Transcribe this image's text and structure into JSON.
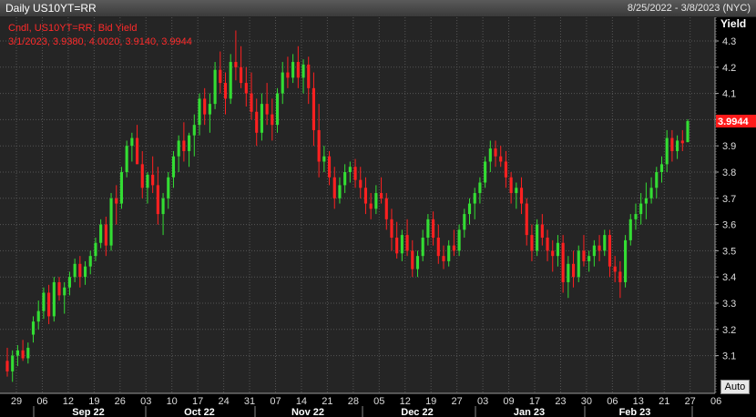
{
  "window": {
    "title": "Daily US10YT=RR",
    "date_range": "8/25/2022 - 3/8/2023 (NYC)"
  },
  "legend": {
    "line1": "Cndl, US10YT=RR, Bid Yield",
    "line2": "3/1/2023, 3.9380, 4.0020, 3.9140, 3.9944"
  },
  "y_axis": {
    "title": "Yield",
    "last_value_label": "3.9944",
    "auto_button": "Auto"
  },
  "colors": {
    "up": "#33dd33",
    "down": "#ff2020",
    "plot_bg": "#252525",
    "grid": "#555555",
    "axis_text": "#dddddd",
    "last_value_bg": "#ff1a1a"
  },
  "chart_data": {
    "type": "candlestick",
    "series_label": "Cndl, US10YT=RR, Bid Yield",
    "ylabel": "Yield",
    "ylim": [
      3.0,
      4.35
    ],
    "y_ticks": [
      3.1,
      3.2,
      3.3,
      3.4,
      3.5,
      3.6,
      3.7,
      3.8,
      3.9,
      4.0,
      4.1,
      4.2,
      4.3
    ],
    "x_day_ticks": [
      "29",
      "06",
      "12",
      "19",
      "26",
      "03",
      "10",
      "17",
      "24",
      "31",
      "07",
      "14",
      "21",
      "28",
      "05",
      "12",
      "19",
      "27",
      "03",
      "09",
      "17",
      "23",
      "30",
      "06",
      "13",
      "21",
      "27",
      "06"
    ],
    "x_month_labels": [
      "Sep 22",
      "Oct 22",
      "Nov 22",
      "Dec 22",
      "Jan 23",
      "Feb 23"
    ],
    "grid": "on",
    "last": {
      "date": "3/1/2023",
      "open": 3.938,
      "high": 4.002,
      "low": 3.914,
      "close": 3.9944
    },
    "candles": [
      [
        3.08,
        3.13,
        3.02,
        3.04
      ],
      [
        3.04,
        3.12,
        3.0,
        3.1
      ],
      [
        3.1,
        3.14,
        3.06,
        3.12
      ],
      [
        3.12,
        3.16,
        3.08,
        3.09
      ],
      [
        3.09,
        3.15,
        3.07,
        3.13
      ],
      [
        3.18,
        3.25,
        3.15,
        3.23
      ],
      [
        3.23,
        3.31,
        3.2,
        3.27
      ],
      [
        3.27,
        3.36,
        3.24,
        3.34
      ],
      [
        3.34,
        3.37,
        3.22,
        3.25
      ],
      [
        3.25,
        3.4,
        3.23,
        3.38
      ],
      [
        3.38,
        3.4,
        3.31,
        3.33
      ],
      [
        3.33,
        3.38,
        3.26,
        3.36
      ],
      [
        3.36,
        3.42,
        3.33,
        3.4
      ],
      [
        3.4,
        3.47,
        3.38,
        3.45
      ],
      [
        3.45,
        3.48,
        3.36,
        3.4
      ],
      [
        3.4,
        3.46,
        3.37,
        3.44
      ],
      [
        3.44,
        3.5,
        3.41,
        3.48
      ],
      [
        3.48,
        3.55,
        3.46,
        3.53
      ],
      [
        3.53,
        3.62,
        3.51,
        3.6
      ],
      [
        3.6,
        3.63,
        3.48,
        3.52
      ],
      [
        3.52,
        3.72,
        3.5,
        3.7
      ],
      [
        3.7,
        3.75,
        3.6,
        3.68
      ],
      [
        3.68,
        3.82,
        3.66,
        3.8
      ],
      [
        3.8,
        3.92,
        3.78,
        3.9
      ],
      [
        3.9,
        3.95,
        3.84,
        3.93
      ],
      [
        3.93,
        3.98,
        3.88,
        3.83
      ],
      [
        3.83,
        3.88,
        3.7,
        3.74
      ],
      [
        3.74,
        3.8,
        3.68,
        3.79
      ],
      [
        3.79,
        3.86,
        3.72,
        3.75
      ],
      [
        3.75,
        3.82,
        3.6,
        3.64
      ],
      [
        3.64,
        3.72,
        3.56,
        3.7
      ],
      [
        3.7,
        3.8,
        3.66,
        3.78
      ],
      [
        3.78,
        3.88,
        3.74,
        3.86
      ],
      [
        3.86,
        3.94,
        3.8,
        3.92
      ],
      [
        3.92,
        3.99,
        3.84,
        3.88
      ],
      [
        3.88,
        3.95,
        3.82,
        3.94
      ],
      [
        3.94,
        4.02,
        3.86,
        3.98
      ],
      [
        3.98,
        4.1,
        3.94,
        4.08
      ],
      [
        4.08,
        4.12,
        3.98,
        4.02
      ],
      [
        4.02,
        4.1,
        3.95,
        4.06
      ],
      [
        4.06,
        4.22,
        4.04,
        4.19
      ],
      [
        4.19,
        4.26,
        4.1,
        4.14
      ],
      [
        4.14,
        4.18,
        4.02,
        4.08
      ],
      [
        4.08,
        4.25,
        4.06,
        4.22
      ],
      [
        4.22,
        4.34,
        4.15,
        4.2
      ],
      [
        4.2,
        4.28,
        4.12,
        4.14
      ],
      [
        4.14,
        4.2,
        4.05,
        4.1
      ],
      [
        4.1,
        4.18,
        4.0,
        4.03
      ],
      [
        4.03,
        4.08,
        3.9,
        3.95
      ],
      [
        3.95,
        4.1,
        3.92,
        4.06
      ],
      [
        4.06,
        4.14,
        3.98,
        4.02
      ],
      [
        4.02,
        4.08,
        3.92,
        3.98
      ],
      [
        3.98,
        4.12,
        3.95,
        4.1
      ],
      [
        4.1,
        4.22,
        4.06,
        4.18
      ],
      [
        4.18,
        4.24,
        4.12,
        4.16
      ],
      [
        4.16,
        4.25,
        4.14,
        4.22
      ],
      [
        4.22,
        4.28,
        4.12,
        4.16
      ],
      [
        4.16,
        4.23,
        4.1,
        4.21
      ],
      [
        4.21,
        4.24,
        4.06,
        4.12
      ],
      [
        4.12,
        4.18,
        3.9,
        3.96
      ],
      [
        3.96,
        4.06,
        3.78,
        3.84
      ],
      [
        3.84,
        3.9,
        3.8,
        3.86
      ],
      [
        3.86,
        3.88,
        3.75,
        3.78
      ],
      [
        3.78,
        3.82,
        3.66,
        3.7
      ],
      [
        3.7,
        3.78,
        3.68,
        3.75
      ],
      [
        3.75,
        3.83,
        3.72,
        3.8
      ],
      [
        3.8,
        3.84,
        3.76,
        3.82
      ],
      [
        3.82,
        3.85,
        3.74,
        3.77
      ],
      [
        3.77,
        3.82,
        3.7,
        3.74
      ],
      [
        3.74,
        3.78,
        3.64,
        3.68
      ],
      [
        3.68,
        3.72,
        3.62,
        3.66
      ],
      [
        3.66,
        3.75,
        3.64,
        3.72
      ],
      [
        3.72,
        3.78,
        3.68,
        3.7
      ],
      [
        3.7,
        3.72,
        3.58,
        3.62
      ],
      [
        3.62,
        3.66,
        3.5,
        3.55
      ],
      [
        3.55,
        3.61,
        3.47,
        3.49
      ],
      [
        3.49,
        3.58,
        3.46,
        3.56
      ],
      [
        3.56,
        3.62,
        3.48,
        3.5
      ],
      [
        3.5,
        3.54,
        3.4,
        3.43
      ],
      [
        3.43,
        3.5,
        3.4,
        3.48
      ],
      [
        3.48,
        3.58,
        3.46,
        3.55
      ],
      [
        3.55,
        3.64,
        3.52,
        3.62
      ],
      [
        3.62,
        3.65,
        3.52,
        3.55
      ],
      [
        3.55,
        3.6,
        3.45,
        3.48
      ],
      [
        3.48,
        3.52,
        3.43,
        3.46
      ],
      [
        3.46,
        3.54,
        3.44,
        3.52
      ],
      [
        3.52,
        3.58,
        3.48,
        3.5
      ],
      [
        3.5,
        3.6,
        3.48,
        3.58
      ],
      [
        3.58,
        3.66,
        3.55,
        3.64
      ],
      [
        3.64,
        3.7,
        3.6,
        3.68
      ],
      [
        3.68,
        3.74,
        3.62,
        3.72
      ],
      [
        3.72,
        3.78,
        3.68,
        3.76
      ],
      [
        3.76,
        3.86,
        3.74,
        3.84
      ],
      [
        3.84,
        3.92,
        3.8,
        3.89
      ],
      [
        3.89,
        3.92,
        3.82,
        3.86
      ],
      [
        3.86,
        3.9,
        3.82,
        3.84
      ],
      [
        3.84,
        3.88,
        3.74,
        3.78
      ],
      [
        3.78,
        3.8,
        3.68,
        3.72
      ],
      [
        3.72,
        3.76,
        3.66,
        3.74
      ],
      [
        3.74,
        3.78,
        3.64,
        3.68
      ],
      [
        3.68,
        3.7,
        3.52,
        3.56
      ],
      [
        3.56,
        3.6,
        3.46,
        3.5
      ],
      [
        3.5,
        3.62,
        3.48,
        3.6
      ],
      [
        3.6,
        3.64,
        3.52,
        3.55
      ],
      [
        3.55,
        3.58,
        3.46,
        3.5
      ],
      [
        3.5,
        3.54,
        3.42,
        3.48
      ],
      [
        3.48,
        3.56,
        3.44,
        3.53
      ],
      [
        3.53,
        3.56,
        3.34,
        3.38
      ],
      [
        3.38,
        3.48,
        3.32,
        3.45
      ],
      [
        3.45,
        3.5,
        3.36,
        3.4
      ],
      [
        3.4,
        3.52,
        3.38,
        3.5
      ],
      [
        3.5,
        3.56,
        3.44,
        3.46
      ],
      [
        3.46,
        3.5,
        3.42,
        3.48
      ],
      [
        3.48,
        3.54,
        3.44,
        3.52
      ],
      [
        3.52,
        3.56,
        3.46,
        3.5
      ],
      [
        3.5,
        3.58,
        3.48,
        3.56
      ],
      [
        3.56,
        3.58,
        3.4,
        3.44
      ],
      [
        3.44,
        3.48,
        3.38,
        3.42
      ],
      [
        3.42,
        3.46,
        3.32,
        3.38
      ],
      [
        3.38,
        3.56,
        3.36,
        3.54
      ],
      [
        3.54,
        3.64,
        3.52,
        3.62
      ],
      [
        3.62,
        3.68,
        3.58,
        3.64
      ],
      [
        3.64,
        3.72,
        3.6,
        3.68
      ],
      [
        3.68,
        3.76,
        3.62,
        3.7
      ],
      [
        3.7,
        3.78,
        3.68,
        3.74
      ],
      [
        3.74,
        3.82,
        3.7,
        3.8
      ],
      [
        3.8,
        3.86,
        3.76,
        3.83
      ],
      [
        3.83,
        3.96,
        3.8,
        3.93
      ],
      [
        3.93,
        3.96,
        3.84,
        3.88
      ],
      [
        3.88,
        3.94,
        3.85,
        3.92
      ],
      [
        3.92,
        3.96,
        3.88,
        3.91
      ],
      [
        3.914,
        4.002,
        3.914,
        3.9944
      ]
    ]
  }
}
